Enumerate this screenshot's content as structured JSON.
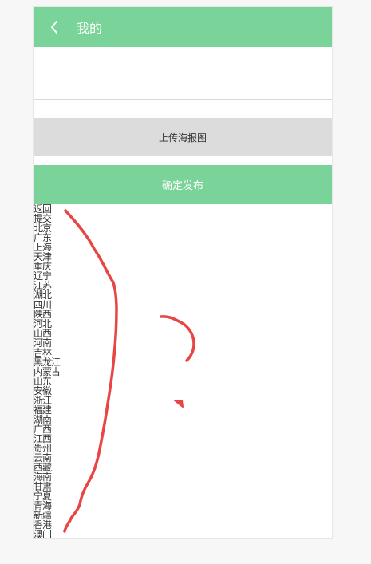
{
  "header": {
    "title": "我的",
    "back_icon": "chevron-left-icon"
  },
  "input": {
    "value": ""
  },
  "buttons": {
    "upload_label": "上传海报图",
    "publish_label": "确定发布"
  },
  "regions": [
    "返回",
    "提交",
    "北京",
    "广东",
    "上海",
    "天津",
    "重庆",
    "辽宁",
    "江苏",
    "湖北",
    "四川",
    "陕西",
    "河北",
    "山西",
    "河南",
    "吉林",
    "黑龙江",
    "内蒙古",
    "山东",
    "安徽",
    "浙江",
    "福建",
    "湖南",
    "广西",
    "江西",
    "贵州",
    "云南",
    "西藏",
    "海南",
    "甘肃",
    "宁夏",
    "青海",
    "新疆",
    "香港",
    "澳门"
  ],
  "colors": {
    "accent": "#7ad49a",
    "stroke": "#e84545",
    "upload_bg": "#dcdcdc"
  }
}
